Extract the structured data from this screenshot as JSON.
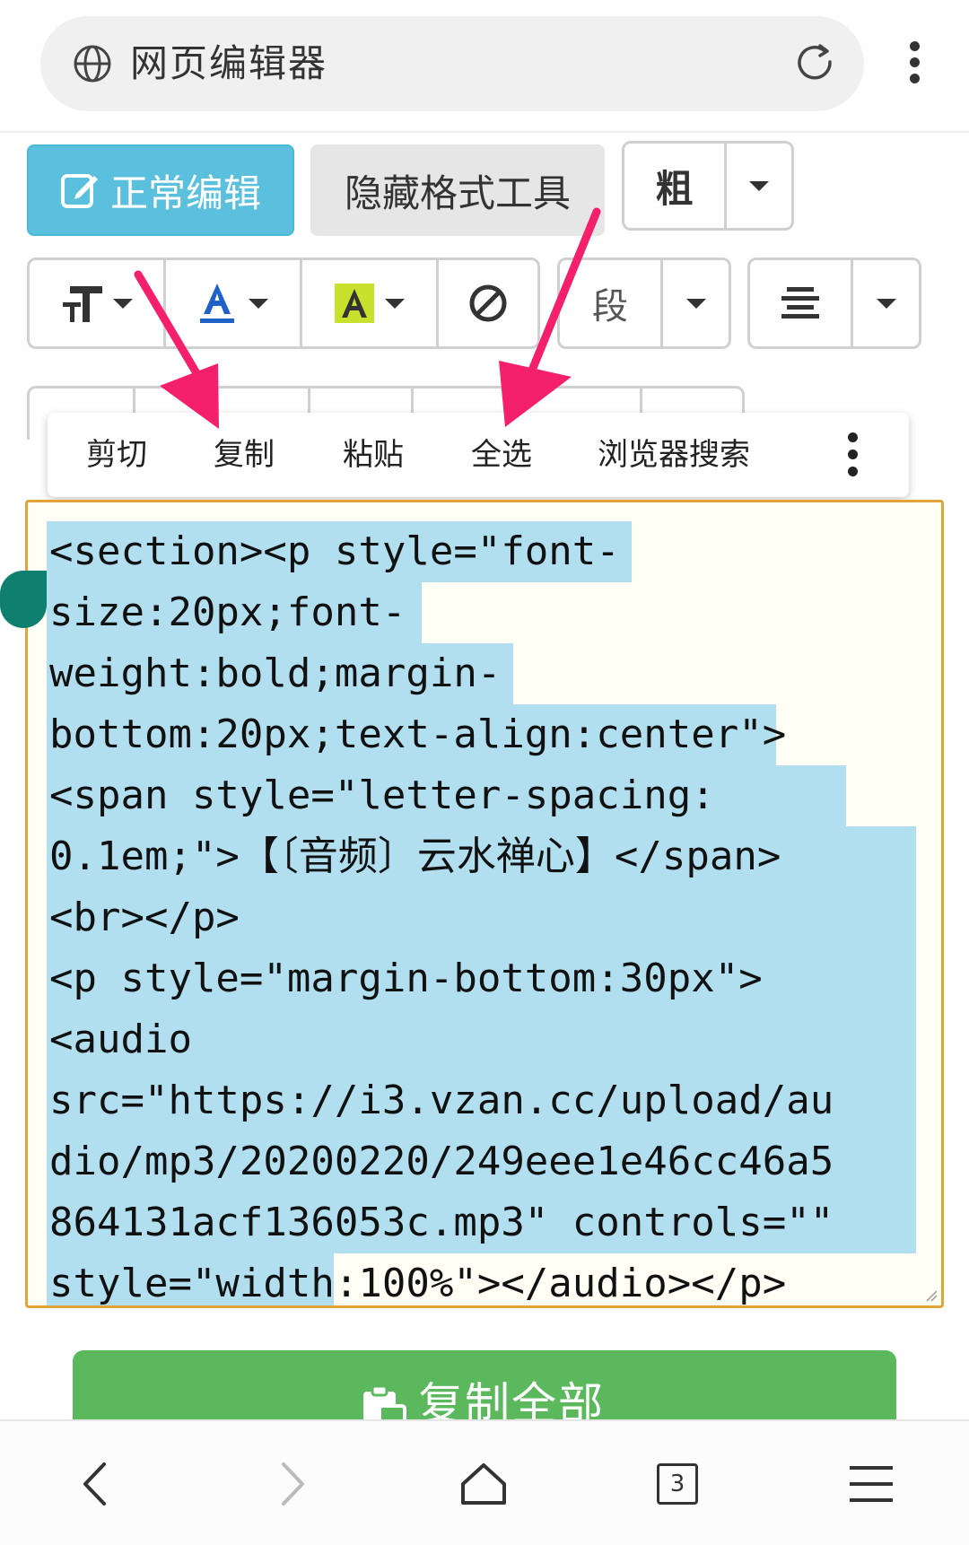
{
  "browser": {
    "page_title": "网页编辑器",
    "icons": {
      "site": "globe-icon",
      "reload": "reload-icon",
      "menu": "more-vertical-icon"
    }
  },
  "toolbar": {
    "normal_edit_label": "正常编辑",
    "hide_format_label": "隐藏格式工具",
    "bold_label": "粗",
    "paragraph_label": "段",
    "icons": [
      "font-size-icon",
      "font-color-icon",
      "highlight-color-icon",
      "clear-format-icon",
      "align-center-icon"
    ]
  },
  "context_menu": {
    "items": [
      "剪切",
      "复制",
      "粘贴",
      "全选",
      "浏览器搜索"
    ]
  },
  "editor": {
    "lines": [
      "<section><p style=\"font-",
      "size:20px;font-",
      "weight:bold;margin-",
      "bottom:20px;text-align:center\">",
      "<span style=\"letter-spacing:",
      "0.1em;\">【〔音频〕云水禅心】</span>",
      "<br></p>",
      "<p style=\"margin-bottom:30px\">",
      "<audio",
      "src=\"https://i3.vzan.cc/upload/au",
      "dio/mp3/20200220/249eee1e46cc46a5",
      "864131acf136053c.mp3\" controls=\"\"",
      "style=\"width:100%\"></audio></p>"
    ],
    "selection_color": "#b1dff0",
    "border_color": "#e0a536"
  },
  "copy_all": {
    "label": "复制全部"
  },
  "bottom_nav": {
    "tab_count": "3",
    "icons": [
      "back-icon",
      "forward-icon",
      "home-icon",
      "tabs-icon",
      "menu-icon"
    ]
  },
  "colors": {
    "info": "#5bc0de",
    "success": "#5cb85c",
    "annotation_arrow": "#f5206b"
  }
}
